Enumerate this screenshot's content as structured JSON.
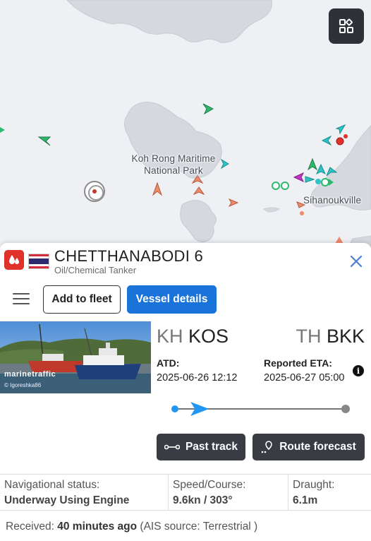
{
  "map": {
    "labels": {
      "park": "Koh Rong Maritime National Park",
      "city": "Sihanoukville"
    },
    "layers_icon": "layers-grid-icon",
    "colors": {
      "water": "#eef0f4",
      "land": "#d5d8de",
      "cargo": "#2fb86b",
      "tanker": "#e0312b",
      "passenger": "#1e88e5",
      "other": "#2ec4c4",
      "pleasure": "#c236c2",
      "fishing": "#ef8a6b"
    }
  },
  "vessel": {
    "name": "CHETTHANABODI 6",
    "type": "Oil/Chemical Tanker",
    "type_icon": "tanker-drop-icon",
    "flag": "Thailand"
  },
  "actions": {
    "add_to_fleet": "Add to fleet",
    "vessel_details": "Vessel details"
  },
  "photo": {
    "brand": "marinetraffic",
    "credit": "© Igoreshka86"
  },
  "voyage": {
    "from_country": "KH",
    "from_port": "KOS",
    "to_country": "TH",
    "to_port": "BKK",
    "atd_label": "ATD:",
    "atd_value": "2025-06-26 12:12",
    "eta_label": "Reported ETA:",
    "eta_value": "2025-06-27 05:00",
    "progress": 0.1
  },
  "buttons": {
    "past_track": "Past track",
    "route_forecast": "Route forecast"
  },
  "stats": {
    "nav_status_label": "Navigational status:",
    "nav_status_value": "Underway Using Engine",
    "speed_label": "Speed/Course:",
    "speed_value": "9.6kn / 303°",
    "draught_label": "Draught:",
    "draught_value": "6.1m"
  },
  "received": {
    "prefix": "Received:",
    "age": "40 minutes ago",
    "source": "(AIS source: Terrestrial )"
  }
}
